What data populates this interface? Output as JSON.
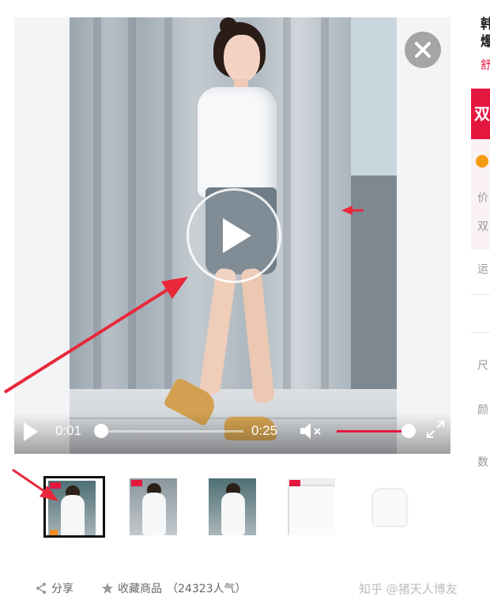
{
  "video": {
    "current_time": "0:01",
    "duration": "0:25",
    "progress_fraction": 0.04,
    "volume_fraction": 1.0,
    "muted": true
  },
  "thumbnails": [
    {
      "name": "thumb-1",
      "selected": true
    },
    {
      "name": "thumb-2",
      "selected": false
    },
    {
      "name": "thumb-3",
      "selected": false
    },
    {
      "name": "thumb-4",
      "selected": false
    },
    {
      "name": "thumb-5",
      "selected": false
    }
  ],
  "actions": {
    "share_label": "分享",
    "favorite_label": "收藏商品",
    "favorite_count": "（24323人气）"
  },
  "watermark": "知乎 @猪天人博友",
  "right_panel": {
    "title": "韩 爆",
    "subtitle": "舒",
    "banner": "双",
    "price_label": "价",
    "double_label": "双",
    "shipping_label": "运",
    "size_label": "尺",
    "color_label": "颜",
    "quantity_label": "数"
  },
  "colors": {
    "accent": "#e4173f",
    "annotation_arrow": "#e8283a"
  },
  "icons": {
    "play": "play-icon",
    "mute": "volume-mute-icon",
    "fullscreen": "fullscreen-icon",
    "close": "close-icon",
    "share": "share-icon",
    "favorite": "star-icon"
  }
}
